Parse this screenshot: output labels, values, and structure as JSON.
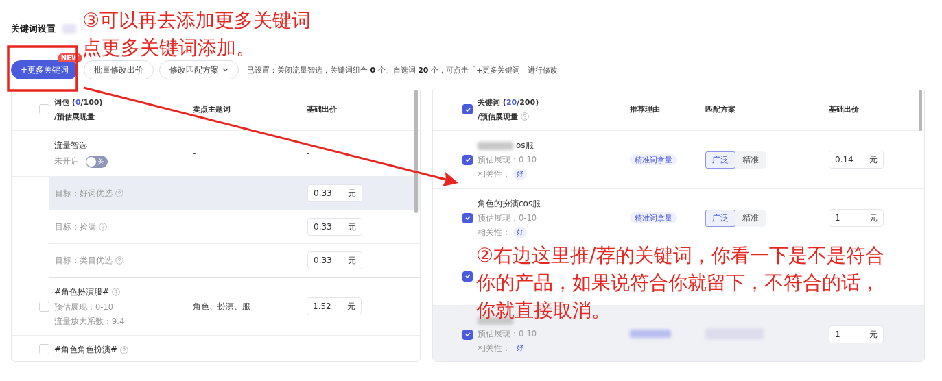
{
  "header": {
    "title": "关键词设置",
    "blurred_after_title": true
  },
  "toolbar": {
    "buttons": [
      {
        "label": "+更多关键词",
        "kind": "primary",
        "badge": "NEW"
      },
      {
        "label": "批量修改出价",
        "kind": "plain"
      },
      {
        "label": "修改匹配方案",
        "kind": "dropdown"
      }
    ],
    "summary": "已设置：关闭流量智选，关键词组合 **0** 个、自选词 **20** 个，可点击「+更多关键词」进行修改"
  },
  "left_table": {
    "header": {
      "title": "词包",
      "count": "(**0**/100)",
      "subtitle": "/预估展现量",
      "checked": false
    },
    "columns": [
      "卖点主题词",
      "基础出价"
    ],
    "smart": {
      "name": "流量智选",
      "status": "未开启",
      "switch_on": false,
      "switch_label": "关",
      "theme": "-",
      "price": "-"
    },
    "goals": [
      {
        "label": "目标：好词优选",
        "price": "0.33",
        "unit": "元",
        "hovered": true
      },
      {
        "label": "目标：捡漏",
        "price": "0.33",
        "unit": "元",
        "hovered": false
      },
      {
        "label": "目标：类目优选",
        "price": "0.33",
        "unit": "元",
        "hovered": false
      }
    ],
    "packages": [
      {
        "name": "#角色扮演服#",
        "estimate": "预估展现：0-10",
        "factor": "流量放大系数：9.4",
        "themes": "角色、扮演、服",
        "price": "1.52",
        "unit": "元",
        "checked": false
      },
      {
        "name": "#角色角色扮演#",
        "checked": false
      }
    ]
  },
  "right_table": {
    "header": {
      "title": "关键词",
      "count": "(**20**/200)",
      "subtitle": "/预估展现量",
      "checked": true
    },
    "columns": [
      "推荐理由",
      "匹配方案",
      "基础出价"
    ],
    "rows": [
      {
        "checked": true,
        "name_blurred": true,
        "name": "os服",
        "estimate": "预估展现：0-10",
        "relevance_label": "相关性：",
        "relevance": "好",
        "reason": "精准词拿量",
        "match": [
          {
            "label": "广泛",
            "selected": true
          },
          {
            "label": "精准",
            "selected": false
          }
        ],
        "price": "0.14",
        "unit": "元",
        "hovered": false
      },
      {
        "checked": true,
        "name": "角色的扮演cos服",
        "estimate": "预估展现：0-10",
        "relevance_label": "相关性：",
        "relevance": "好",
        "reason": "精准词拿量",
        "match": [
          {
            "label": "广泛",
            "selected": true
          },
          {
            "label": "精准",
            "selected": false
          }
        ],
        "price": "1",
        "unit": "元",
        "hovered": false
      },
      {
        "checked": true,
        "hovered": false
      },
      {
        "checked": true,
        "name_blurred": true,
        "estimate": "预估展现：0-10",
        "relevance_label": "相关性：",
        "relevance": "好",
        "reason_blurred": true,
        "match_blurred": true,
        "price": "1",
        "unit": "元",
        "hovered": true
      }
    ]
  },
  "annotations": [
    {
      "kind": "add-more",
      "lines": [
        "③可以再去添加更多关键词",
        "点更多关键词添加。"
      ]
    },
    {
      "kind": "recommend",
      "lines": [
        "②右边这里推/荐的关键词，你看一下是不是符合",
        "你的产品，如果说符合你就留下，不符合的话，",
        "你就直接取消。"
      ]
    }
  ]
}
